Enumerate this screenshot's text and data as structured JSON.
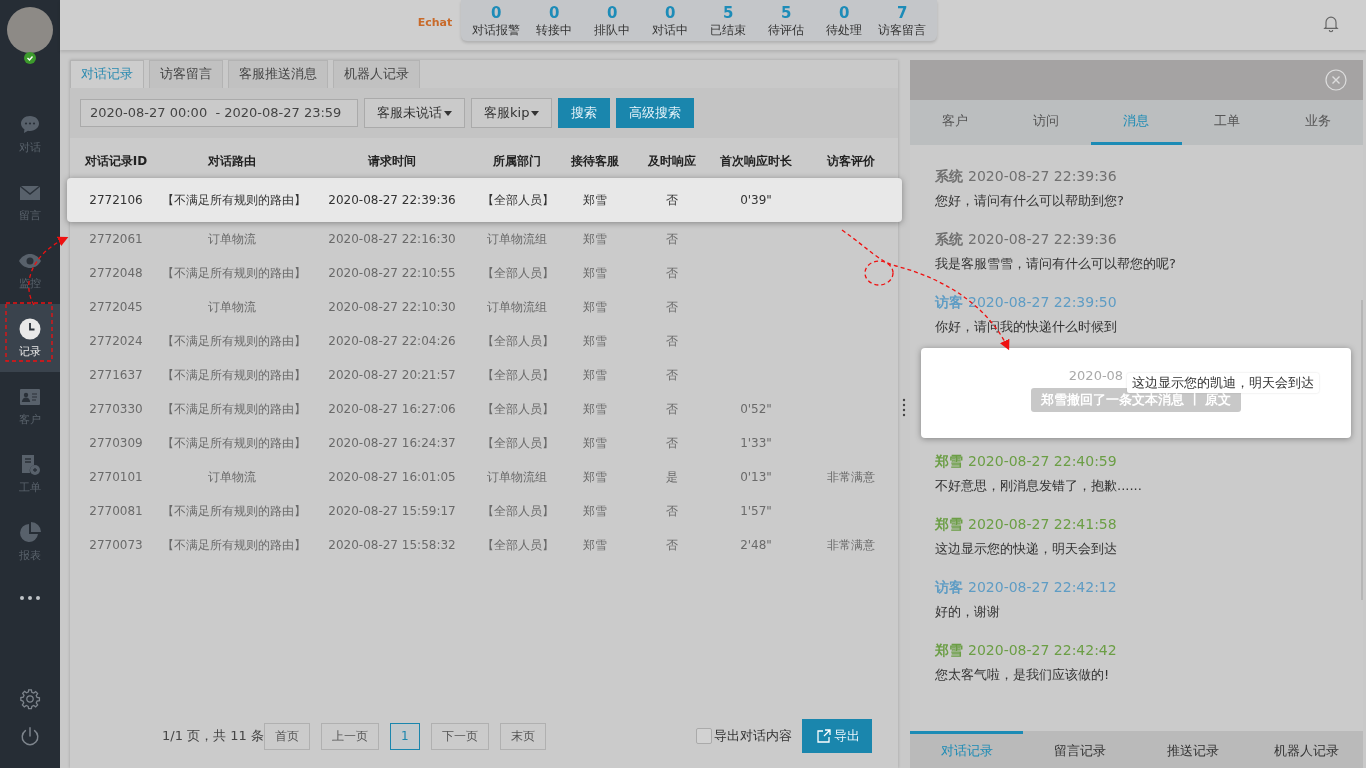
{
  "sidebar": {
    "items": [
      {
        "label": "对话",
        "selected": false
      },
      {
        "label": "留言",
        "selected": false
      },
      {
        "label": "监控",
        "selected": false
      },
      {
        "label": "记录",
        "selected": true
      },
      {
        "label": "客户",
        "selected": false
      },
      {
        "label": "工单",
        "selected": false
      },
      {
        "label": "报表",
        "selected": false
      }
    ],
    "online": true
  },
  "topbar": {
    "logo": "Echat",
    "stats": [
      {
        "count": "0",
        "label": "对话报警"
      },
      {
        "count": "0",
        "label": "转接中"
      },
      {
        "count": "0",
        "label": "排队中"
      },
      {
        "count": "0",
        "label": "对话中"
      },
      {
        "count": "5",
        "label": "已结束"
      },
      {
        "count": "5",
        "label": "待评估"
      },
      {
        "count": "0",
        "label": "待处理"
      },
      {
        "count": "7",
        "label": "访客留言"
      }
    ]
  },
  "tabs": [
    {
      "label": "对话记录",
      "selected": true
    },
    {
      "label": "访客留言",
      "selected": false
    },
    {
      "label": "客服推送消息",
      "selected": false
    },
    {
      "label": "机器人记录",
      "selected": false
    }
  ],
  "filters": {
    "date_range": "2020-08-27 00:00  - 2020-08-27 23:59",
    "dropdowns": [
      "客服未说话",
      "客服kip"
    ],
    "search_button": "搜索",
    "advanced_button": "高级搜索"
  },
  "table": {
    "columns": [
      "对话记录ID",
      "对话路由",
      "请求时间",
      "所属部门",
      "接待客服",
      "及时响应",
      "首次响应时长",
      "访客评价"
    ],
    "rows": [
      {
        "selected": true,
        "cells": [
          "2772106",
          "【不满足所有规则的路由】",
          "2020-08-27 22:39:36",
          "【全部人员】",
          "郑雪",
          "否",
          "0'39\"",
          ""
        ]
      },
      {
        "selected": false,
        "cells": [
          "2772061",
          "订单物流",
          "2020-08-27 22:16:30",
          "订单物流组",
          "郑雪",
          "否",
          "",
          ""
        ]
      },
      {
        "selected": false,
        "cells": [
          "2772048",
          "【不满足所有规则的路由】",
          "2020-08-27 22:10:55",
          "【全部人员】",
          "郑雪",
          "否",
          "",
          ""
        ]
      },
      {
        "selected": false,
        "cells": [
          "2772045",
          "订单物流",
          "2020-08-27 22:10:30",
          "订单物流组",
          "郑雪",
          "否",
          "",
          ""
        ]
      },
      {
        "selected": false,
        "cells": [
          "2772024",
          "【不满足所有规则的路由】",
          "2020-08-27 22:04:26",
          "【全部人员】",
          "郑雪",
          "否",
          "",
          ""
        ]
      },
      {
        "selected": false,
        "cells": [
          "2771637",
          "【不满足所有规则的路由】",
          "2020-08-27 20:21:57",
          "【全部人员】",
          "郑雪",
          "否",
          "",
          ""
        ]
      },
      {
        "selected": false,
        "cells": [
          "2770330",
          "【不满足所有规则的路由】",
          "2020-08-27 16:27:06",
          "【全部人员】",
          "郑雪",
          "否",
          "0'52\"",
          ""
        ]
      },
      {
        "selected": false,
        "cells": [
          "2770309",
          "【不满足所有规则的路由】",
          "2020-08-27 16:24:37",
          "【全部人员】",
          "郑雪",
          "否",
          "1'33\"",
          ""
        ]
      },
      {
        "selected": false,
        "cells": [
          "2770101",
          "订单物流",
          "2020-08-27 16:01:05",
          "订单物流组",
          "郑雪",
          "是",
          "0'13\"",
          "非常满意"
        ]
      },
      {
        "selected": false,
        "cells": [
          "2770081",
          "【不满足所有规则的路由】",
          "2020-08-27 15:59:17",
          "【全部人员】",
          "郑雪",
          "否",
          "1'57\"",
          ""
        ]
      },
      {
        "selected": false,
        "cells": [
          "2770073",
          "【不满足所有规则的路由】",
          "2020-08-27 15:58:32",
          "【全部人员】",
          "郑雪",
          "否",
          "2'48\"",
          "非常满意"
        ]
      }
    ]
  },
  "pagination": {
    "summary": "1/1 页，共 11 条",
    "pages": [
      {
        "label": "首页",
        "selected": false
      },
      {
        "label": "上一页",
        "selected": false
      },
      {
        "label": "1",
        "selected": true
      },
      {
        "label": "下一页",
        "selected": false
      },
      {
        "label": "末页",
        "selected": false
      }
    ]
  },
  "export": {
    "checkbox_label": "导出对话内容",
    "checked": false,
    "button": "导出"
  },
  "detail": {
    "tabs": [
      {
        "label": "客户",
        "selected": false
      },
      {
        "label": "访问",
        "selected": false
      },
      {
        "label": "消息",
        "selected": true
      },
      {
        "label": "工单",
        "selected": false
      },
      {
        "label": "业务",
        "selected": false
      }
    ],
    "messages": [
      {
        "kind": "system",
        "sender": "系统",
        "time": "2020-08-27 22:39:36",
        "text": "您好，请问有什么可以帮助到您?"
      },
      {
        "kind": "system",
        "sender": "系统",
        "time": "2020-08-27 22:39:36",
        "text": "我是客服雪雪，请问有什么可以帮您的呢?"
      },
      {
        "kind": "visitor",
        "sender": "访客",
        "time": "2020-08-27 22:39:50",
        "text": "你好，请问我的快递什么时候到"
      },
      {
        "kind": "recalled",
        "time": "2020-08",
        "notice": "郑雪撤回了一条文本消息",
        "separator": "|",
        "link": "原文",
        "tooltip": "这边显示您的凯迪，明天会到达"
      },
      {
        "kind": "agent",
        "sender": "郑雪",
        "time": "2020-08-27 22:40:59",
        "text": "不好意思，刚消息发错了，抱歉......"
      },
      {
        "kind": "agent",
        "sender": "郑雪",
        "time": "2020-08-27 22:41:58",
        "text": "这边显示您的快递，明天会到达"
      },
      {
        "kind": "visitor",
        "sender": "访客",
        "time": "2020-08-27 22:42:12",
        "text": "好的，谢谢"
      },
      {
        "kind": "agent",
        "sender": "郑雪",
        "time": "2020-08-27 22:42:42",
        "text": "您太客气啦，是我们应该做的!"
      }
    ],
    "bottom_tabs": [
      {
        "label": "对话记录",
        "selected": true
      },
      {
        "label": "留言记录",
        "selected": false
      },
      {
        "label": "推送记录",
        "selected": false
      },
      {
        "label": "机器人记录",
        "selected": false
      }
    ]
  }
}
